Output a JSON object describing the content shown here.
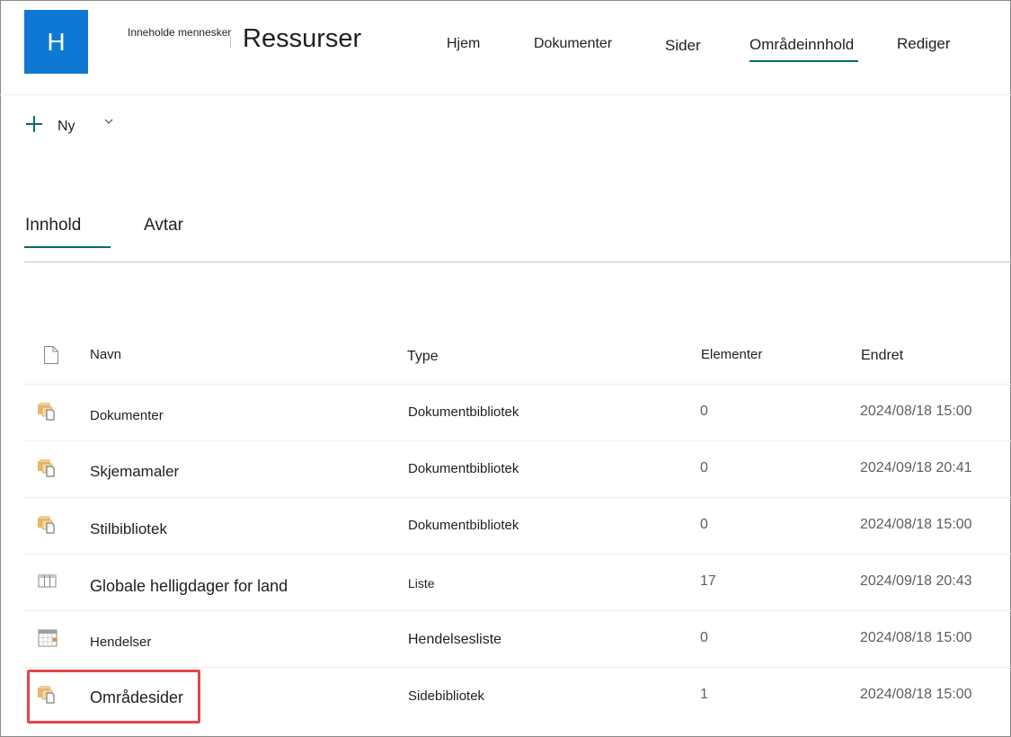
{
  "site": {
    "logo_letter": "H",
    "subtitle": "Inneholde mennesker",
    "title": "Ressurser"
  },
  "nav": {
    "items": [
      "Hjem",
      "Dokumenter",
      "Sider",
      "Områdeinnhold",
      "Rediger"
    ],
    "active": "Områdeinnhold"
  },
  "command_bar": {
    "new_label": "Ny"
  },
  "pivots": {
    "items": [
      "Innhold",
      "Avtar"
    ],
    "active": "Innhold"
  },
  "table": {
    "headers": {
      "name": "Navn",
      "type": "Type",
      "items": "Elementer",
      "modified": "Endret"
    },
    "rows": [
      {
        "icon": "document-library-icon",
        "name": "Dokumenter",
        "type": "Dokumentbibliotek",
        "items": "0",
        "modified": "2024/08/18 15:00"
      },
      {
        "icon": "document-library-icon",
        "name": "Skjemamaler",
        "type": "Dokumentbibliotek",
        "items": "0",
        "modified": "2024/09/18 20:41"
      },
      {
        "icon": "document-library-icon",
        "name": "Stilbibliotek",
        "type": "Dokumentbibliotek",
        "items": "0",
        "modified": "2024/08/18 15:00"
      },
      {
        "icon": "list-icon",
        "name": "Globale helligdager for land",
        "type": "Liste",
        "items": "17",
        "modified": "2024/09/18 20:43"
      },
      {
        "icon": "calendar-icon",
        "name": "Hendelser",
        "type": "Hendelsesliste",
        "items": "0",
        "modified": "2024/08/18 15:00"
      },
      {
        "icon": "document-library-icon",
        "name": "Områdesider",
        "type": "Sidebibliotek",
        "items": "1",
        "modified": "2024/08/18 15:00",
        "highlighted": true
      }
    ]
  },
  "colors": {
    "brand": "#0f78d4",
    "accent": "#036c70",
    "highlight": "#e0474c",
    "folder": "#e8b86a"
  }
}
